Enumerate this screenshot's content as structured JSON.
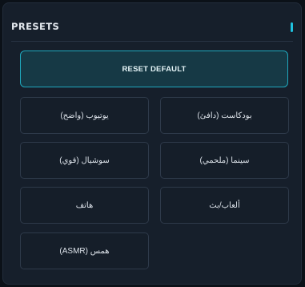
{
  "panel": {
    "title": "PRESETS",
    "accent_color": "#1fc3e0"
  },
  "reset_button": {
    "label": "RESET DEFAULT"
  },
  "presets": [
    {
      "label": "بودكاست (دافئ)"
    },
    {
      "label": "يوتيوب (واضح)"
    },
    {
      "label": "سينما (ملحمي)"
    },
    {
      "label": "سوشيال (قوي)"
    },
    {
      "label": "ألعاب/بث"
    },
    {
      "label": "هاتف"
    },
    {
      "label": "همس (ASMR)"
    }
  ]
}
